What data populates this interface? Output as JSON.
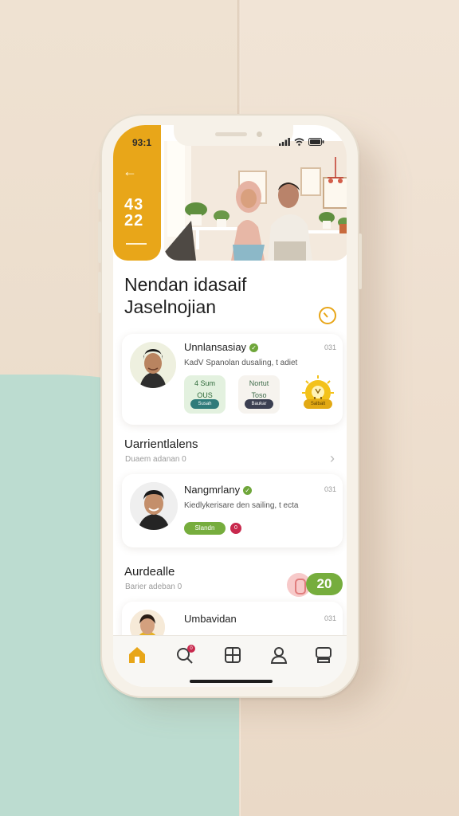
{
  "status_bar": {
    "time": "93:1"
  },
  "hero": {
    "number": "43\n22"
  },
  "title": "Nendan idasaif\nJaselnojian",
  "featured_card": {
    "name": "Unnlansasiay",
    "description": "KadV Spanolan dusaling, t adiet",
    "meta": "031",
    "tiles": [
      {
        "line1": "4 Sum",
        "line2": "OUS",
        "pill": "Susah"
      },
      {
        "line1": "Nortut",
        "line2": "Toso",
        "pill": "Baukar"
      },
      {
        "line1": "",
        "line2": "",
        "pill": "Salbalt"
      }
    ]
  },
  "section_1": {
    "title": "Uarrientlalens",
    "subtitle": "Duaem adanan 0"
  },
  "second_card": {
    "name": "Nangmrlany",
    "description": "Kiedlykerisare den sailing, t ecta",
    "meta": "031",
    "pill": "Slandn",
    "dot": "0"
  },
  "section_2": {
    "title": "Aurdealle",
    "subtitle": "Barier adeban 0",
    "badge": "20"
  },
  "third_card": {
    "name": "Umbavidan",
    "meta": "031"
  },
  "colors": {
    "accent": "#e8a619",
    "green": "#76ad3d",
    "red": "#c8294d"
  },
  "nav": {
    "items": [
      "home-icon",
      "search-icon",
      "grid-icon",
      "profile-icon",
      "inbox-icon"
    ],
    "search_badge": "0"
  }
}
